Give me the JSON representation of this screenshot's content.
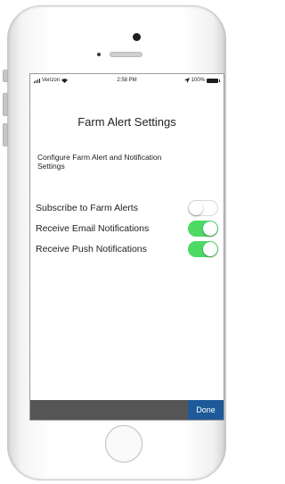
{
  "status_bar": {
    "carrier": "Verizon",
    "time": "2:58 PM",
    "battery": "100%",
    "icons": [
      "signal-bars-icon",
      "wifi-icon",
      "location-arrow-icon",
      "battery-icon"
    ]
  },
  "screen": {
    "title": "Farm Alert Settings",
    "description": "Configure Farm Alert and Notification Settings",
    "settings": [
      {
        "label": "Subscribe to Farm Alerts",
        "enabled": false
      },
      {
        "label": "Receive Email Notifications",
        "enabled": true
      },
      {
        "label": "Receive Push Notifications",
        "enabled": true
      }
    ],
    "done_label": "Done"
  },
  "colors": {
    "toggle_on": "#4cd964",
    "toolbar": "#555555",
    "done_button": "#1d5a97"
  }
}
